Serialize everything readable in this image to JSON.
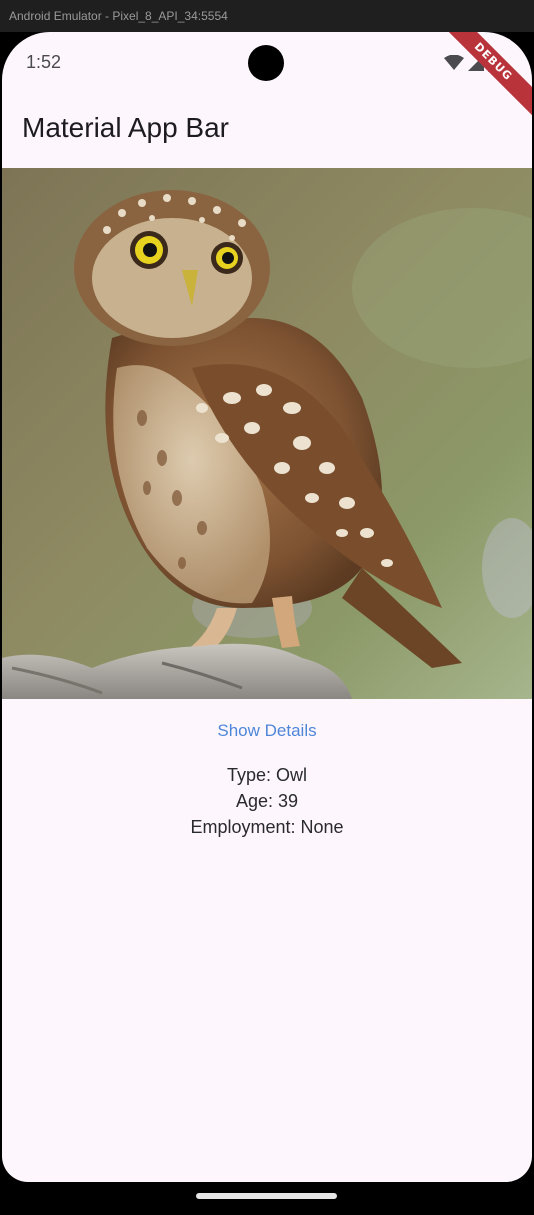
{
  "window": {
    "title": "Android Emulator - Pixel_8_API_34:5554"
  },
  "statusbar": {
    "time": "1:52",
    "icons": [
      "wifi-icon",
      "cell-signal-icon",
      "battery-icon"
    ],
    "debug_banner": "DEBUG"
  },
  "appbar": {
    "title": "Material App Bar"
  },
  "image": {
    "subject": "owl-photo"
  },
  "details": {
    "button_label": "Show Details",
    "type": "Type: Owl",
    "age": "Age: 39",
    "employment": "Employment: None"
  },
  "colors": {
    "background": "#fdf7fd",
    "accent": "#4f86d8",
    "debug": "#b8343a"
  }
}
